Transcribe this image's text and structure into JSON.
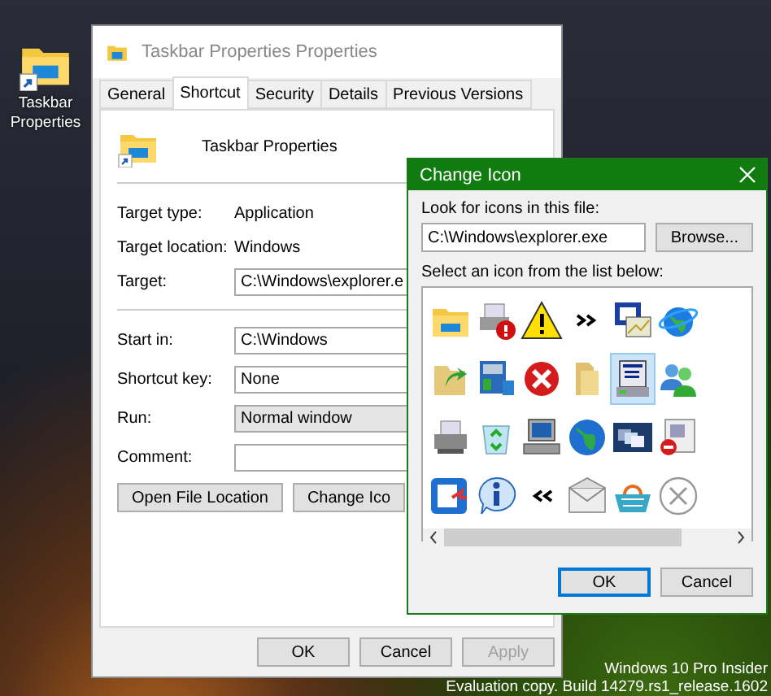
{
  "desktop": {
    "shortcut_label": "Taskbar Properties",
    "system_info": [
      "Windows 10 Pro Insider",
      "Evaluation copy. Build 14279.rs1_release.1602"
    ]
  },
  "properties_window": {
    "title": "Taskbar Properties Properties",
    "tabs": [
      {
        "label": "General",
        "selected": false
      },
      {
        "label": "Shortcut",
        "selected": true
      },
      {
        "label": "Security",
        "selected": false
      },
      {
        "label": "Details",
        "selected": false
      },
      {
        "label": "Previous Versions",
        "selected": false
      }
    ],
    "shortcut_name": "Taskbar Properties",
    "info": [
      {
        "label": "Target type:",
        "value": "Application"
      },
      {
        "label": "Target location:",
        "value": "Windows"
      }
    ],
    "target": {
      "label": "Target:",
      "value": "C:\\Windows\\explorer.e"
    },
    "fields": [
      {
        "label": "Start in:",
        "value": "C:\\Windows",
        "kind": "text"
      },
      {
        "label": "Shortcut key:",
        "value": "None",
        "kind": "text"
      },
      {
        "label": "Run:",
        "value": "Normal window",
        "kind": "dropdown"
      },
      {
        "label": "Comment:",
        "kind": "text"
      }
    ],
    "actions": [
      "Open File Location",
      "Change Ico"
    ],
    "buttons": [
      {
        "label": "OK",
        "disabled": false
      },
      {
        "label": "Cancel",
        "disabled": false
      },
      {
        "label": "Apply",
        "disabled": true
      }
    ]
  },
  "change_icon_dialog": {
    "title": "Change Icon",
    "file_label": "Look for icons in this file:",
    "file_value": "C:\\Windows\\explorer.exe",
    "browse": "Browse...",
    "list_label": "Select an icon from the list below:",
    "icons": [
      {
        "kind": "folder",
        "selected": false
      },
      {
        "kind": "printer-help",
        "selected": false
      },
      {
        "kind": "warning",
        "selected": false
      },
      {
        "kind": "chevrons-right",
        "selected": false
      },
      {
        "kind": "document-window",
        "selected": false
      },
      {
        "kind": "globe-ring",
        "selected": false
      },
      {
        "kind": "folder-arrow",
        "selected": false
      },
      {
        "kind": "control-panel",
        "selected": false
      },
      {
        "kind": "error",
        "selected": false
      },
      {
        "kind": "folder-narrow",
        "selected": false
      },
      {
        "kind": "computer-tower",
        "selected": true
      },
      {
        "kind": "users",
        "selected": false
      },
      {
        "kind": "printer",
        "selected": false
      },
      {
        "kind": "recycle-bin",
        "selected": false
      },
      {
        "kind": "computer",
        "selected": false
      },
      {
        "kind": "globe",
        "selected": false
      },
      {
        "kind": "windows",
        "selected": false
      },
      {
        "kind": "blocked-document",
        "selected": false
      },
      {
        "kind": "document-arrow",
        "selected": false
      },
      {
        "kind": "info",
        "selected": false
      },
      {
        "kind": "chevrons-left",
        "selected": false
      },
      {
        "kind": "envelope",
        "selected": false
      },
      {
        "kind": "basket",
        "selected": false
      },
      {
        "kind": "close-circle",
        "selected": false
      }
    ],
    "buttons": [
      {
        "label": "OK",
        "default": true
      },
      {
        "label": "Cancel",
        "default": false
      }
    ]
  }
}
